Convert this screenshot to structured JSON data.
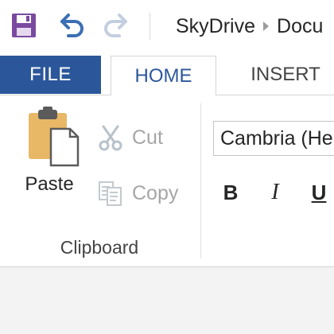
{
  "quick_access": {
    "save_icon": "save-icon",
    "undo_icon": "undo-icon",
    "redo_icon": "redo-icon",
    "breadcrumb": [
      "SkyDrive",
      "Documents"
    ],
    "breadcrumb_visible": [
      "SkyDrive",
      "Docu"
    ]
  },
  "tabs": {
    "file": "FILE",
    "home": "HOME",
    "insert": "INSERT"
  },
  "clipboard": {
    "paste": "Paste",
    "cut": "Cut",
    "copy": "Copy",
    "group_label": "Clipboard"
  },
  "font": {
    "family_value": "Cambria (He",
    "bold": "B",
    "italic": "I",
    "underline": "U"
  },
  "colors": {
    "accent": "#2b579a",
    "save_icon": "#7a4aa0",
    "undo_icon": "#3b6fb4",
    "disabled": "#a6a6a6"
  }
}
